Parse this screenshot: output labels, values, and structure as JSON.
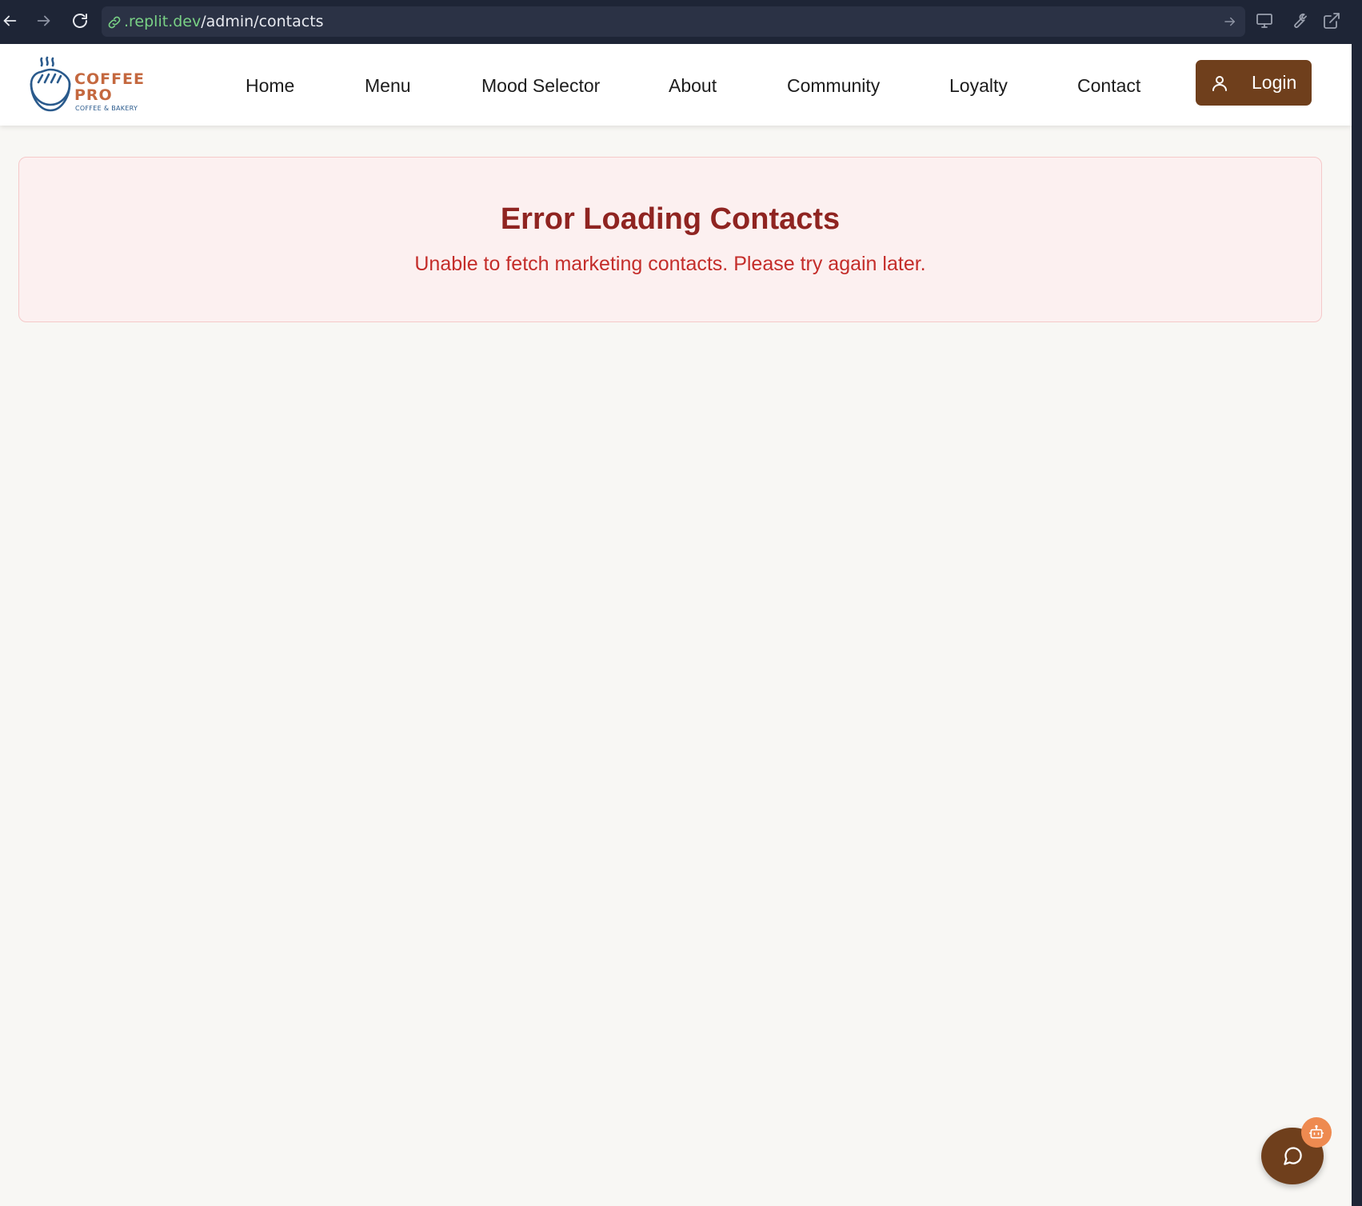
{
  "browser": {
    "url_domain": ".replit.dev",
    "url_path": "/admin/contacts",
    "icons": [
      "back-arrow-icon",
      "forward-arrow-icon",
      "reload-icon",
      "link-icon",
      "go-arrow-icon",
      "monitor-icon",
      "wrench-icon",
      "open-external-icon"
    ]
  },
  "logo": {
    "word_line1": "COFFEE",
    "word_line2": "PRO",
    "tagline": "COFFEE & BAKERY",
    "word_color": "#c4683f",
    "mark_color": "#2a5a8c"
  },
  "nav": {
    "items": [
      {
        "label": "Home"
      },
      {
        "label": "Menu"
      },
      {
        "label": "Mood Selector"
      },
      {
        "label": "About"
      },
      {
        "label": "Community"
      },
      {
        "label": "Loyalty"
      },
      {
        "label": "Contact"
      }
    ],
    "login_label": "Login",
    "login_icon": "user-icon"
  },
  "error": {
    "title": "Error Loading Contacts",
    "message": "Unable to fetch marketing contacts. Please try again later."
  },
  "chat_widget": {
    "icon": "chat-bubble-icon",
    "badge_icon": "bot-icon"
  },
  "colors": {
    "brand_brown": "#6f3f1c",
    "page_bg": "#f8f7f4",
    "error_bg": "#fcf0f0",
    "error_title": "#8f2421",
    "error_text": "#c42d2a",
    "badge_orange": "#ee8a50"
  }
}
